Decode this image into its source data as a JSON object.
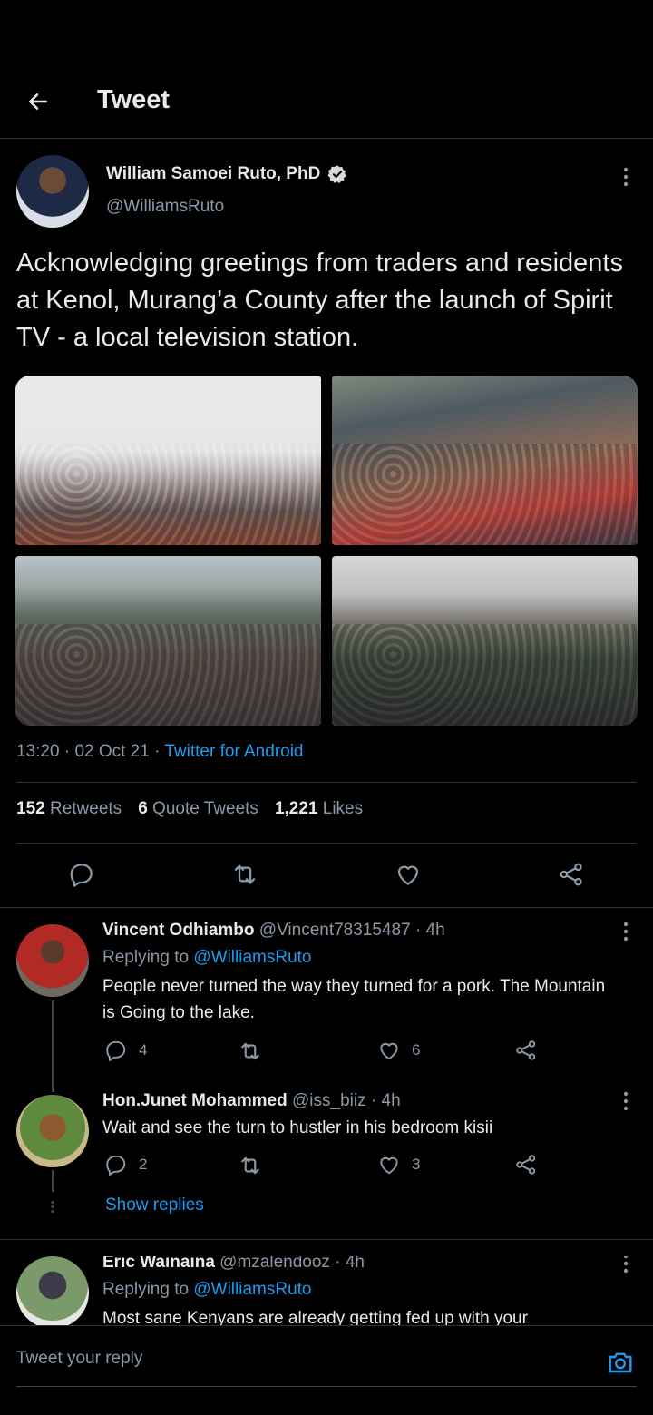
{
  "header": {
    "title": "Tweet"
  },
  "tweet": {
    "author_name": "William Samoei Ruto, PhD",
    "author_handle": "@WilliamsRuto",
    "text": "Acknowledging greetings from traders and residents at Kenol, Murang’a County after the launch of Spirit TV - a local television station.",
    "time": "13:20",
    "date": "02 Oct 21",
    "source": "Twitter for Android",
    "retweets_count": "152",
    "retweets_label": "Retweets",
    "quote_count": "6",
    "quote_label": "Quote Tweets",
    "likes_count": "1,221",
    "likes_label": "Likes"
  },
  "replies": [
    {
      "name": "Vincent Odhiambo",
      "handle": "@Vincent78315487",
      "time": "4h",
      "replying_prefix": "Replying to",
      "replying_to": "@WilliamsRuto",
      "text": "People never turned the way they turned for a pork. The Mountain is Going to the lake.",
      "reply_count": "4",
      "like_count": "6"
    },
    {
      "name": "Hon.Junet Mohammed",
      "handle": "@iss_biiz",
      "time": "4h",
      "text": "Wait and see the turn to hustler in his bedroom kisii",
      "reply_count": "2",
      "like_count": "3",
      "show_replies": "Show replies"
    },
    {
      "name": "Eric Wainaina",
      "handle": "@mzalendooz",
      "time": "4h",
      "replying_prefix": "Replying to",
      "replying_to": "@WilliamsRuto",
      "text": "Most sane Kenyans are already getting fed up with your"
    }
  ],
  "compose": {
    "placeholder": "Tweet your reply"
  },
  "colors": {
    "accent": "#1d9bf0",
    "background": "#000000",
    "muted": "#8b98a5",
    "divider": "#2f3336"
  }
}
